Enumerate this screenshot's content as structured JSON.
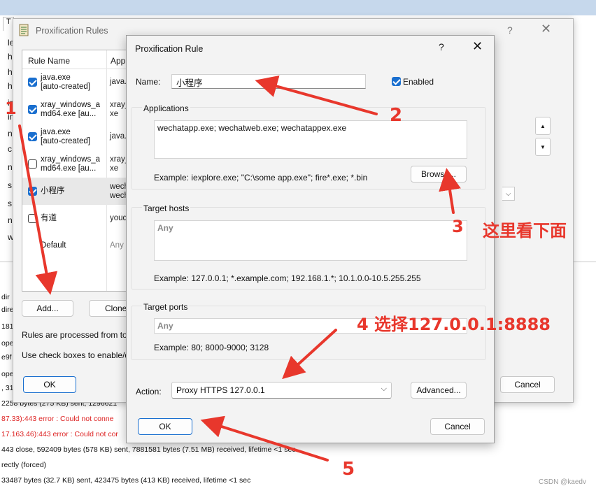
{
  "background": {
    "main_tab_label": "T",
    "left_column_chars": [
      "le",
      "h",
      "h",
      "h",
      "in",
      "in",
      "n",
      "c",
      "n",
      "s",
      "s",
      "n",
      "w"
    ],
    "log_lines": [
      {
        "text": "dir",
        "error": false
      },
      {
        "text": "dire",
        "error": false
      },
      {
        "text": "181-",
        "error": false
      },
      {
        "text": "ope",
        "error": false
      },
      {
        "text": "e9f",
        "error": false
      },
      {
        "text": "ope",
        "error": false
      },
      {
        "text": ", 31",
        "error": false
      },
      {
        "text": "2258 bytes (275 KB) sent, 1296621",
        "error": false
      },
      {
        "text": "87.33):443 error : Could not conne",
        "error": true
      },
      {
        "text": "17.163.46):443 error : Could not cor",
        "error": true
      },
      {
        "text": "443 close, 592409 bytes (578 KB) sent, 7881581 bytes (7.51 MB) received, lifetime <1 sec",
        "error": false
      },
      {
        "text": "rectly (forced)",
        "error": false
      },
      {
        "text": "33487 bytes (32.7 KB) sent, 423475 bytes (413 KB) received, lifetime <1 sec",
        "error": false
      }
    ]
  },
  "rules_window": {
    "title": "Proxification Rules",
    "help": "?",
    "close": "✕",
    "columns": {
      "name": "Rule Name",
      "apps": "Appli"
    },
    "rules": [
      {
        "name": "java.exe\n[auto-created]",
        "apps": "java.",
        "checked": true
      },
      {
        "name": "xray_windows_a\nmd64.exe [au...",
        "apps": "xray_\nxe",
        "checked": true
      },
      {
        "name": "java.exe\n[auto-created]",
        "apps": "java.",
        "checked": true
      },
      {
        "name": "xray_windows_a\nmd64.exe [au...",
        "apps": "xray_\nxe",
        "checked": false
      },
      {
        "name": "小程序",
        "apps": "wech\nwech",
        "checked": true
      },
      {
        "name": "有道",
        "apps": "youd",
        "checked": false
      },
      {
        "name": "Default",
        "apps": "Any",
        "checked": null
      }
    ],
    "add_label": "Add...",
    "clone_label": "Clone",
    "note1": "Rules are processed from top",
    "note2": "Use check boxes to enable/d",
    "ok_label": "OK",
    "cancel_label": "Cancel",
    "scroll_up": "▲",
    "scroll_down": "▼",
    "combo_chevron": "⌵"
  },
  "rule_dialog": {
    "title": "Proxification Rule",
    "help": "?",
    "close": "✕",
    "name_label": "Name:",
    "name_value": "小程序",
    "enabled_label": "Enabled",
    "enabled": true,
    "applications_label": "Applications",
    "applications_value": "wechatapp.exe; wechatweb.exe; wechatappex.exe",
    "applications_example": "Example: iexplore.exe; \"C:\\some app.exe\"; fire*.exe; *.bin",
    "browse_label": "Browse...",
    "target_hosts_label": "Target hosts",
    "target_hosts_value": "Any",
    "target_hosts_example": "Example: 127.0.0.1; *.example.com; 192.168.1.*; 10.1.0.0-10.5.255.255",
    "target_ports_label": "Target ports",
    "target_ports_value": "Any",
    "target_ports_example": "Example: 80; 8000-9000; 3128",
    "action_label": "Action:",
    "action_value": "Proxy HTTPS 127.0.0.1",
    "action_chevron": "⌵",
    "advanced_label": "Advanced...",
    "ok_label": "OK",
    "cancel_label": "Cancel"
  },
  "annotations": {
    "n1": "1",
    "n2": "2",
    "n3": "3",
    "n3_text": "这里看下面",
    "n4": "4 选择127.0.0.1:8888",
    "n5": "5",
    "color": "#e8372c"
  },
  "watermark": "CSDN @kaedv"
}
